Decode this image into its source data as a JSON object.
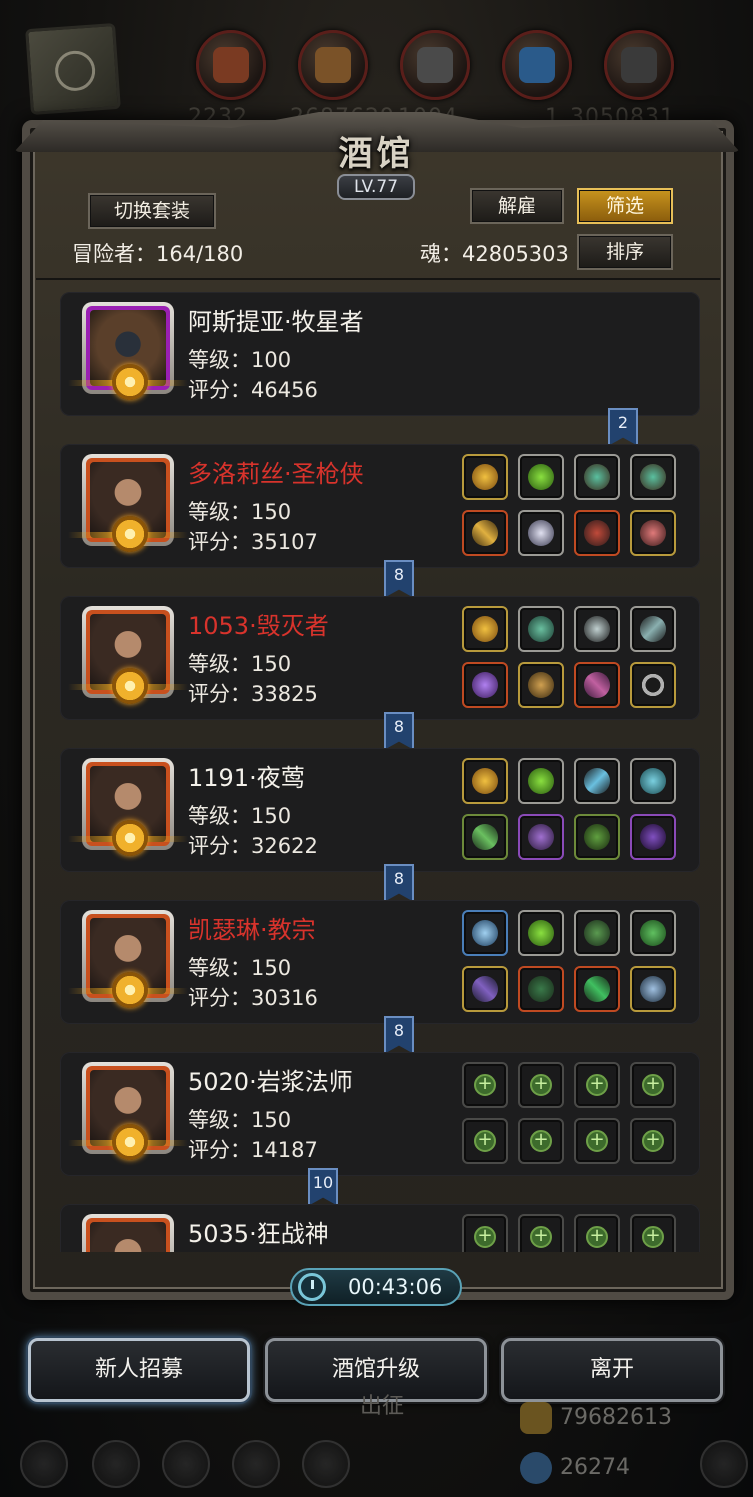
{
  "window": {
    "title": "酒馆",
    "level": "LV.77"
  },
  "background": {
    "numbers": [
      "2232",
      "2687629",
      "1004",
      "1",
      "3050831"
    ],
    "dimmed_text": "出征",
    "currencies": [
      {
        "name": "gold",
        "icon": "gold-bars-icon",
        "value": "79682613"
      },
      {
        "name": "diamond",
        "icon": "diamond-icon",
        "value": "26274"
      }
    ]
  },
  "toolbar": {
    "switch_outfit": "切换套装",
    "dismiss": "解雇",
    "filter": "筛选",
    "sort": "排序",
    "adventurer_label": "冒险者：164/180",
    "soul_label": "魂：42805303"
  },
  "heroes": [
    {
      "name": "阿斯提亚·牧星者",
      "name_color": "white",
      "level": "等级：100",
      "score": "评分：46456",
      "frame": "purple",
      "equipment": []
    },
    {
      "name": "多洛莉丝·圣枪侠",
      "name_color": "red",
      "level": "等级：150",
      "score": "评分：35107",
      "frame": "orange",
      "equipment": [
        "crown-icon",
        "helmet-icon",
        "bracer-icon",
        "bracer-icon",
        "rifle-icon",
        "armor-icon",
        "gauntlet-icon",
        "amulet-icon"
      ]
    },
    {
      "name": "1053·毁灭者",
      "name_color": "red",
      "level": "等级：150",
      "score": "评分：33825",
      "frame": "orange",
      "equipment": [
        "crown-icon",
        "gem-icon",
        "rune-icon",
        "spear-icon",
        "staff-icon",
        "helmet-icon",
        "blade-icon",
        "ring-icon"
      ]
    },
    {
      "name": "1191·夜莺",
      "name_color": "white",
      "level": "等级：150",
      "score": "评分：32622",
      "frame": "orange",
      "equipment": [
        "crown-icon",
        "helmet-icon",
        "feather-icon",
        "stone-icon",
        "dagger-icon",
        "armor-icon",
        "ring-icon",
        "ring-icon"
      ]
    },
    {
      "name": "凯瑟琳·教宗",
      "name_color": "red",
      "level": "等级：150",
      "score": "评分：30316",
      "frame": "orange",
      "equipment": [
        "orb-icon",
        "helmet-icon",
        "armor-icon",
        "tome-icon",
        "staff-icon",
        "helmet-icon",
        "sword-icon",
        "amulet-icon"
      ]
    },
    {
      "name": "5020·岩浆法师",
      "name_color": "white",
      "level": "等级：150",
      "score": "评分：14187",
      "frame": "orange",
      "equipment": [
        "empty-slot-icon",
        "empty-slot-icon",
        "empty-slot-icon",
        "empty-slot-icon",
        "empty-slot-icon",
        "empty-slot-icon",
        "empty-slot-icon",
        "empty-slot-icon"
      ]
    },
    {
      "name": "5035·狂战神",
      "name_color": "white",
      "level": "",
      "score": "",
      "frame": "orange",
      "equipment": [
        "empty-slot-icon",
        "empty-slot-icon",
        "empty-slot-icon",
        "empty-slot-icon"
      ]
    }
  ],
  "ribbons": [
    "2",
    "8",
    "8",
    "8",
    "8",
    "10"
  ],
  "timer": "00:43:06",
  "bottom_buttons": {
    "recruit": "新人招募",
    "upgrade": "酒馆升级",
    "leave": "离开"
  },
  "colors": {
    "accent_gold": "#c8941e",
    "name_red": "#d8332c",
    "ribbon_blue": "#22426e"
  }
}
